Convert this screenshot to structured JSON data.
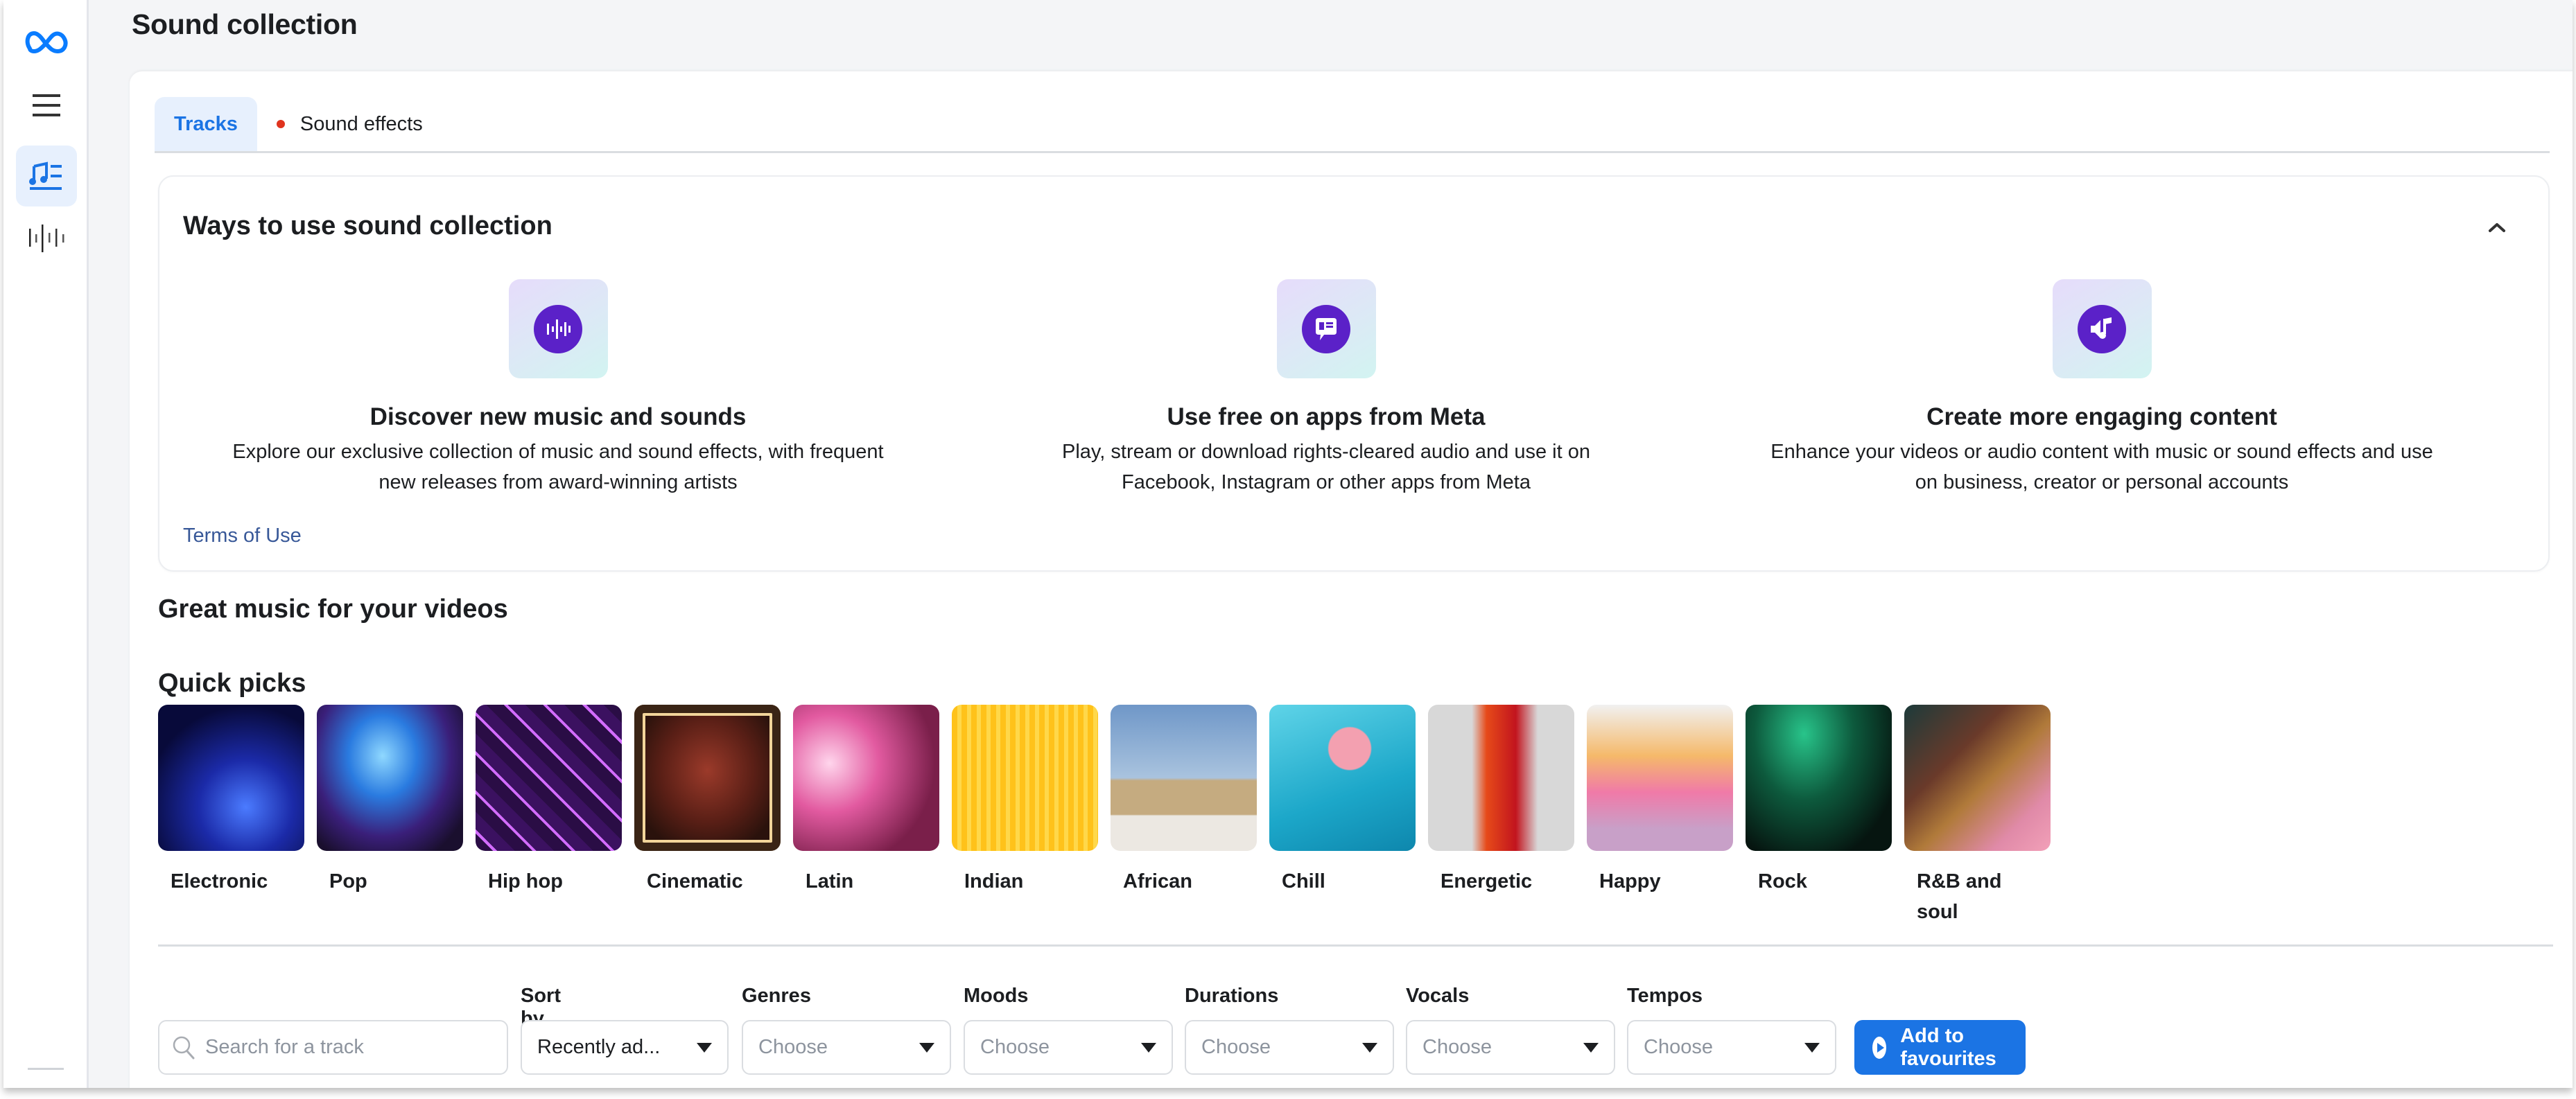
{
  "app": {
    "title": "Sound collection"
  },
  "sidebar": {
    "items": [
      {
        "name": "meta-logo",
        "icon": "meta-infinity-icon"
      },
      {
        "name": "menu",
        "icon": "hamburger-menu-icon"
      },
      {
        "name": "tracks",
        "icon": "music-list-icon",
        "active": true
      },
      {
        "name": "sound-effects",
        "icon": "waveform-icon"
      }
    ]
  },
  "tabs": [
    {
      "label": "Tracks",
      "active": true
    },
    {
      "label": "Sound effects",
      "active": false,
      "badge_dot": true
    }
  ],
  "ways": {
    "title": "Ways to use sound collection",
    "collapse_icon": "chevron-up-icon",
    "features": [
      {
        "icon": "audio-wave-icon",
        "title": "Discover new music and sounds",
        "desc_line1": "Explore our exclusive collection of music and sound effects, with frequent",
        "desc_line2": "new releases from award-winning artists"
      },
      {
        "icon": "chat-bubble-icon",
        "title": "Use free on apps from Meta",
        "desc_line1": "Play, stream or download rights-cleared audio and use it on",
        "desc_line2": "Facebook, Instagram or other apps from Meta"
      },
      {
        "icon": "music-note-speaker-icon",
        "title": "Create more engaging content",
        "desc_line1": "Enhance your videos or audio content with music or sound effects and use",
        "desc_line2": "on business, creator or personal accounts"
      }
    ],
    "terms_link": "Terms of Use"
  },
  "section_title": "Great music for your videos",
  "quick_picks": {
    "title": "Quick picks",
    "items": [
      {
        "label": "Electronic"
      },
      {
        "label": "Pop"
      },
      {
        "label": "Hip hop"
      },
      {
        "label": "Cinematic"
      },
      {
        "label": "Latin"
      },
      {
        "label": "Indian"
      },
      {
        "label": "African"
      },
      {
        "label": "Chill"
      },
      {
        "label": "Energetic"
      },
      {
        "label": "Happy"
      },
      {
        "label": "Rock"
      },
      {
        "label": "R&B and soul"
      }
    ]
  },
  "filters": {
    "search": {
      "placeholder": "Search for a track",
      "value": ""
    },
    "sort_by": {
      "label": "Sort by",
      "value": "Recently ad..."
    },
    "genres": {
      "label": "Genres",
      "value": "Choose"
    },
    "moods": {
      "label": "Moods",
      "value": "Choose"
    },
    "durations": {
      "label": "Durations",
      "value": "Choose"
    },
    "vocals": {
      "label": "Vocals",
      "value": "Choose"
    },
    "tempos": {
      "label": "Tempos",
      "value": "Choose"
    },
    "add_favourites_label": "Add to favourites"
  },
  "colors": {
    "accent": "#1b74e4",
    "feature_icon": "#5b21c8",
    "tab_dot": "#e0341e",
    "link": "#385898"
  }
}
